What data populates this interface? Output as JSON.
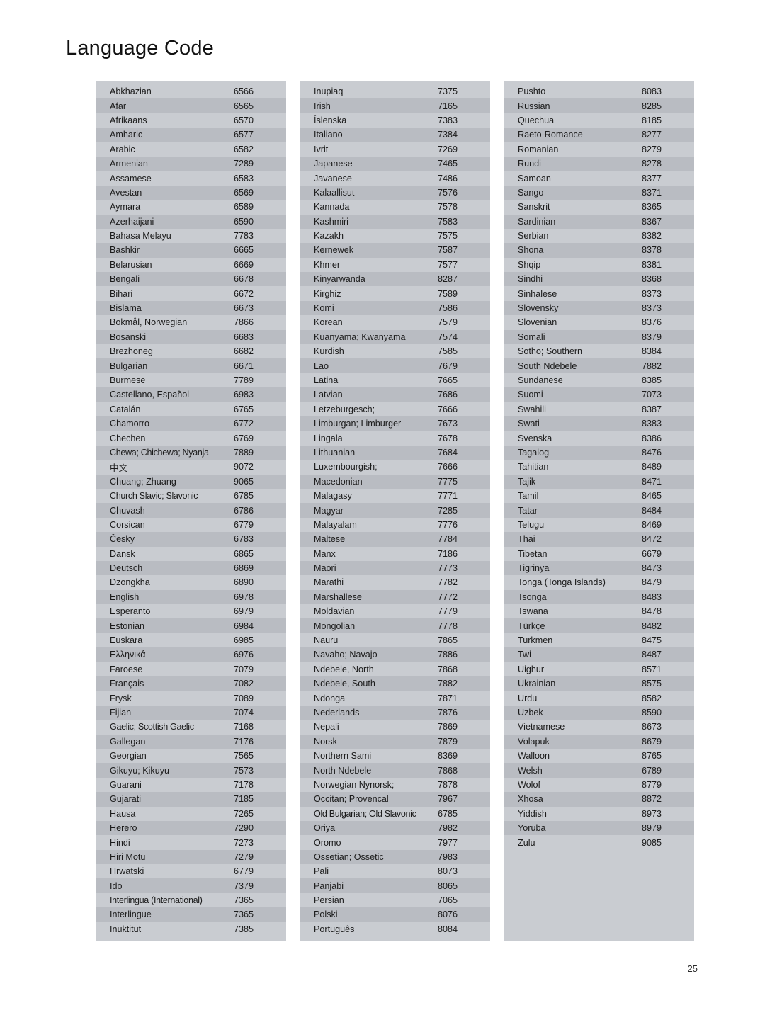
{
  "document": {
    "title": "Language Code",
    "page_number": "25"
  },
  "columns": [
    {
      "rows": [
        {
          "name": "Abkhazian",
          "code": "6566"
        },
        {
          "name": "Afar",
          "code": "6565"
        },
        {
          "name": "Afrikaans",
          "code": "6570"
        },
        {
          "name": "Amharic",
          "code": "6577"
        },
        {
          "name": "Arabic",
          "code": "6582"
        },
        {
          "name": "Armenian",
          "code": "7289"
        },
        {
          "name": "Assamese",
          "code": "6583"
        },
        {
          "name": "Avestan",
          "code": "6569"
        },
        {
          "name": "Aymara",
          "code": "6589"
        },
        {
          "name": "Azerhaijani",
          "code": "6590"
        },
        {
          "name": "Bahasa Melayu",
          "code": "7783"
        },
        {
          "name": "Bashkir",
          "code": "6665"
        },
        {
          "name": "Belarusian",
          "code": "6669"
        },
        {
          "name": "Bengali",
          "code": "6678"
        },
        {
          "name": "Bihari",
          "code": "6672"
        },
        {
          "name": "Bislama",
          "code": "6673"
        },
        {
          "name": "Bokmål, Norwegian",
          "code": "7866"
        },
        {
          "name": "Bosanski",
          "code": "6683"
        },
        {
          "name": "Brezhoneg",
          "code": "6682"
        },
        {
          "name": "Bulgarian",
          "code": "6671"
        },
        {
          "name": "Burmese",
          "code": "7789"
        },
        {
          "name": "Castellano, Español",
          "code": "6983"
        },
        {
          "name": "Catalán",
          "code": "6765"
        },
        {
          "name": "Chamorro",
          "code": "6772"
        },
        {
          "name": "Chechen",
          "code": "6769"
        },
        {
          "name": "Chewa; Chichewa; Nyanja",
          "code": "7889"
        },
        {
          "name": "中文",
          "code": "9072"
        },
        {
          "name": "Chuang; Zhuang",
          "code": "9065"
        },
        {
          "name": "Church Slavic; Slavonic",
          "code": "6785"
        },
        {
          "name": "Chuvash",
          "code": "6786"
        },
        {
          "name": "Corsican",
          "code": "6779"
        },
        {
          "name": "Česky",
          "code": "6783"
        },
        {
          "name": "Dansk",
          "code": "6865"
        },
        {
          "name": "Deutsch",
          "code": "6869"
        },
        {
          "name": "Dzongkha",
          "code": "6890"
        },
        {
          "name": "English",
          "code": "6978"
        },
        {
          "name": "Esperanto",
          "code": "6979"
        },
        {
          "name": "Estonian",
          "code": "6984"
        },
        {
          "name": "Euskara",
          "code": "6985"
        },
        {
          "name": "Ελληνικά",
          "code": "6976"
        },
        {
          "name": "Faroese",
          "code": "7079"
        },
        {
          "name": "Français",
          "code": "7082"
        },
        {
          "name": "Frysk",
          "code": "7089"
        },
        {
          "name": "Fijian",
          "code": "7074"
        },
        {
          "name": "Gaelic; Scottish Gaelic",
          "code": "7168"
        },
        {
          "name": "Gallegan",
          "code": "7176"
        },
        {
          "name": "Georgian",
          "code": "7565"
        },
        {
          "name": "Gikuyu; Kikuyu",
          "code": "7573"
        },
        {
          "name": "Guarani",
          "code": "7178"
        },
        {
          "name": "Gujarati",
          "code": "7185"
        },
        {
          "name": "Hausa",
          "code": "7265"
        },
        {
          "name": "Herero",
          "code": "7290"
        },
        {
          "name": "Hindi",
          "code": "7273"
        },
        {
          "name": "Hiri Motu",
          "code": "7279"
        },
        {
          "name": "Hrwatski",
          "code": "6779"
        },
        {
          "name": "Ido",
          "code": "7379"
        },
        {
          "name": "Interlingua (International)",
          "code": "7365"
        },
        {
          "name": "Interlingue",
          "code": "7365"
        },
        {
          "name": "Inuktitut",
          "code": "7385"
        }
      ]
    },
    {
      "rows": [
        {
          "name": "Inupiaq",
          "code": "7375"
        },
        {
          "name": "Irish",
          "code": "7165"
        },
        {
          "name": "Íslenska",
          "code": "7383"
        },
        {
          "name": "Italiano",
          "code": "7384"
        },
        {
          "name": "Ivrit",
          "code": "7269"
        },
        {
          "name": "Japanese",
          "code": "7465"
        },
        {
          "name": "Javanese",
          "code": "7486"
        },
        {
          "name": "Kalaallisut",
          "code": "7576"
        },
        {
          "name": "Kannada",
          "code": "7578"
        },
        {
          "name": "Kashmiri",
          "code": "7583"
        },
        {
          "name": "Kazakh",
          "code": "7575"
        },
        {
          "name": "Kernewek",
          "code": "7587"
        },
        {
          "name": "Khmer",
          "code": "7577"
        },
        {
          "name": "Kinyarwanda",
          "code": "8287"
        },
        {
          "name": "Kirghiz",
          "code": "7589"
        },
        {
          "name": "Komi",
          "code": "7586"
        },
        {
          "name": "Korean",
          "code": "7579"
        },
        {
          "name": "Kuanyama; Kwanyama",
          "code": "7574"
        },
        {
          "name": "Kurdish",
          "code": "7585"
        },
        {
          "name": "Lao",
          "code": "7679"
        },
        {
          "name": "Latina",
          "code": "7665"
        },
        {
          "name": "Latvian",
          "code": "7686"
        },
        {
          "name": "Letzeburgesch;",
          "code": "7666"
        },
        {
          "name": "Limburgan; Limburger",
          "code": "7673"
        },
        {
          "name": "Lingala",
          "code": "7678"
        },
        {
          "name": "Lithuanian",
          "code": "7684"
        },
        {
          "name": "Luxembourgish;",
          "code": "7666"
        },
        {
          "name": "Macedonian",
          "code": "7775"
        },
        {
          "name": "Malagasy",
          "code": "7771"
        },
        {
          "name": "Magyar",
          "code": "7285"
        },
        {
          "name": "Malayalam",
          "code": "7776"
        },
        {
          "name": "Maltese",
          "code": "7784"
        },
        {
          "name": "Manx",
          "code": "7186"
        },
        {
          "name": "Maori",
          "code": "7773"
        },
        {
          "name": "Marathi",
          "code": "7782"
        },
        {
          "name": "Marshallese",
          "code": "7772"
        },
        {
          "name": "Moldavian",
          "code": "7779"
        },
        {
          "name": "Mongolian",
          "code": "7778"
        },
        {
          "name": "Nauru",
          "code": "7865"
        },
        {
          "name": "Navaho; Navajo",
          "code": "7886"
        },
        {
          "name": "Ndebele, North",
          "code": "7868"
        },
        {
          "name": "Ndebele, South",
          "code": "7882"
        },
        {
          "name": "Ndonga",
          "code": "7871"
        },
        {
          "name": "Nederlands",
          "code": "7876"
        },
        {
          "name": "Nepali",
          "code": "7869"
        },
        {
          "name": "Norsk",
          "code": "7879"
        },
        {
          "name": "Northern Sami",
          "code": "8369"
        },
        {
          "name": "North Ndebele",
          "code": "7868"
        },
        {
          "name": "Norwegian Nynorsk;",
          "code": "7878"
        },
        {
          "name": "Occitan; Provencal",
          "code": "7967"
        },
        {
          "name": "Old Bulgarian; Old Slavonic",
          "code": "6785"
        },
        {
          "name": "Oriya",
          "code": "7982"
        },
        {
          "name": "Oromo",
          "code": "7977"
        },
        {
          "name": "Ossetian; Ossetic",
          "code": "7983"
        },
        {
          "name": "Pali",
          "code": "8073"
        },
        {
          "name": "Panjabi",
          "code": "8065"
        },
        {
          "name": "Persian",
          "code": "7065"
        },
        {
          "name": "Polski",
          "code": "8076"
        },
        {
          "name": "Português",
          "code": "8084"
        }
      ]
    },
    {
      "rows": [
        {
          "name": "Pushto",
          "code": "8083"
        },
        {
          "name": "Russian",
          "code": "8285"
        },
        {
          "name": "Quechua",
          "code": "8185"
        },
        {
          "name": "Raeto-Romance",
          "code": "8277"
        },
        {
          "name": "Romanian",
          "code": "8279"
        },
        {
          "name": "Rundi",
          "code": "8278"
        },
        {
          "name": "Samoan",
          "code": "8377"
        },
        {
          "name": "Sango",
          "code": "8371"
        },
        {
          "name": "Sanskrit",
          "code": "8365"
        },
        {
          "name": "Sardinian",
          "code": "8367"
        },
        {
          "name": "Serbian",
          "code": "8382"
        },
        {
          "name": "Shona",
          "code": "8378"
        },
        {
          "name": "Shqip",
          "code": "8381"
        },
        {
          "name": "Sindhi",
          "code": "8368"
        },
        {
          "name": "Sinhalese",
          "code": "8373"
        },
        {
          "name": "Slovensky",
          "code": "8373"
        },
        {
          "name": "Slovenian",
          "code": "8376"
        },
        {
          "name": "Somali",
          "code": "8379"
        },
        {
          "name": "Sotho; Southern",
          "code": "8384"
        },
        {
          "name": "South Ndebele",
          "code": "7882"
        },
        {
          "name": "Sundanese",
          "code": "8385"
        },
        {
          "name": "Suomi",
          "code": "7073"
        },
        {
          "name": "Swahili",
          "code": "8387"
        },
        {
          "name": "Swati",
          "code": "8383"
        },
        {
          "name": "Svenska",
          "code": "8386"
        },
        {
          "name": "Tagalog",
          "code": "8476"
        },
        {
          "name": "Tahitian",
          "code": "8489"
        },
        {
          "name": "Tajik",
          "code": "8471"
        },
        {
          "name": "Tamil",
          "code": "8465"
        },
        {
          "name": "Tatar",
          "code": "8484"
        },
        {
          "name": "Telugu",
          "code": "8469"
        },
        {
          "name": "Thai",
          "code": "8472"
        },
        {
          "name": "Tibetan",
          "code": "6679"
        },
        {
          "name": "Tigrinya",
          "code": "8473"
        },
        {
          "name": "Tonga (Tonga Islands)",
          "code": "8479"
        },
        {
          "name": "Tsonga",
          "code": "8483"
        },
        {
          "name": "Tswana",
          "code": "8478"
        },
        {
          "name": "Türkçe",
          "code": "8482"
        },
        {
          "name": "Turkmen",
          "code": "8475"
        },
        {
          "name": "Twi",
          "code": "8487"
        },
        {
          "name": "Uighur",
          "code": "8571"
        },
        {
          "name": "Ukrainian",
          "code": "8575"
        },
        {
          "name": "Urdu",
          "code": "8582"
        },
        {
          "name": "Uzbek",
          "code": "8590"
        },
        {
          "name": "Vietnamese",
          "code": "8673"
        },
        {
          "name": "Volapuk",
          "code": "8679"
        },
        {
          "name": "Walloon",
          "code": "8765"
        },
        {
          "name": "Welsh",
          "code": "6789"
        },
        {
          "name": "Wolof",
          "code": "8779"
        },
        {
          "name": "Xhosa",
          "code": "8872"
        },
        {
          "name": "Yiddish",
          "code": "8973"
        },
        {
          "name": "Yoruba",
          "code": "8979"
        },
        {
          "name": "Zulu",
          "code": "9085"
        }
      ]
    }
  ]
}
